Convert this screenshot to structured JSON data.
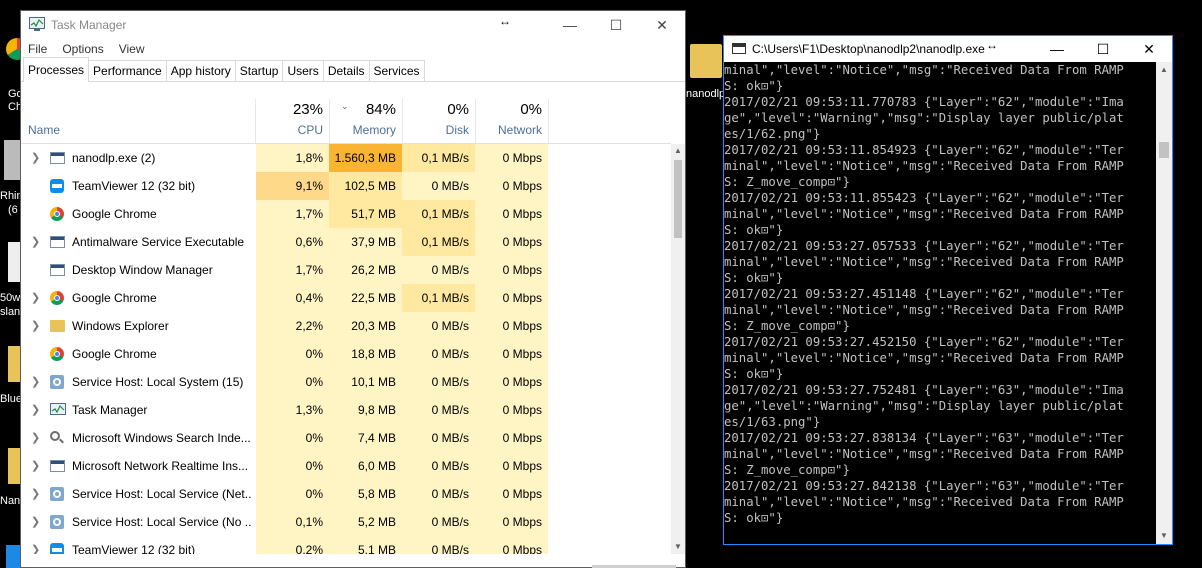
{
  "desktop": {
    "left_labels": [
      "Go",
      "Ch",
      "Rhin",
      "(6",
      "50w",
      "slan",
      "Blue",
      "Nan"
    ],
    "folder_label": "nanodlp"
  },
  "task_manager": {
    "title": "Task Manager",
    "menu": [
      "File",
      "Options",
      "View"
    ],
    "tabs": [
      "Processes",
      "Performance",
      "App history",
      "Startup",
      "Users",
      "Details",
      "Services"
    ],
    "active_tab": "Processes",
    "columns": {
      "name": "Name",
      "cpu": {
        "label": "CPU",
        "pct": "23%"
      },
      "memory": {
        "label": "Memory",
        "pct": "84%"
      },
      "disk": {
        "label": "Disk",
        "pct": "0%"
      },
      "network": {
        "label": "Network",
        "pct": "0%"
      }
    },
    "processes": [
      {
        "expand": true,
        "icon": "app-window-icon",
        "name": "nanodlp.exe (2)",
        "cpu": "1,8%",
        "mem": "1.560,3 MB",
        "disk": "0,1 MB/s",
        "net": "0 Mbps"
      },
      {
        "expand": false,
        "icon": "teamviewer-icon",
        "name": "TeamViewer 12 (32 bit)",
        "cpu": "9,1%",
        "mem": "102,5 MB",
        "disk": "0 MB/s",
        "net": "0 Mbps"
      },
      {
        "expand": false,
        "icon": "chrome-icon",
        "name": "Google Chrome",
        "cpu": "1,7%",
        "mem": "51,7 MB",
        "disk": "0,1 MB/s",
        "net": "0 Mbps"
      },
      {
        "expand": true,
        "icon": "app-window-icon",
        "name": "Antimalware Service Executable",
        "cpu": "0,6%",
        "mem": "37,9 MB",
        "disk": "0,1 MB/s",
        "net": "0 Mbps"
      },
      {
        "expand": false,
        "icon": "app-window-icon",
        "name": "Desktop Window Manager",
        "cpu": "1,7%",
        "mem": "26,2 MB",
        "disk": "0 MB/s",
        "net": "0 Mbps"
      },
      {
        "expand": true,
        "icon": "chrome-icon",
        "name": "Google Chrome",
        "cpu": "0,4%",
        "mem": "22,5 MB",
        "disk": "0,1 MB/s",
        "net": "0 Mbps"
      },
      {
        "expand": true,
        "icon": "folder-icon",
        "name": "Windows Explorer",
        "cpu": "2,2%",
        "mem": "20,3 MB",
        "disk": "0 MB/s",
        "net": "0 Mbps"
      },
      {
        "expand": false,
        "icon": "chrome-icon",
        "name": "Google Chrome",
        "cpu": "0%",
        "mem": "18,8 MB",
        "disk": "0 MB/s",
        "net": "0 Mbps"
      },
      {
        "expand": true,
        "icon": "gear-icon",
        "name": "Service Host: Local System (15)",
        "cpu": "0%",
        "mem": "10,1 MB",
        "disk": "0 MB/s",
        "net": "0 Mbps"
      },
      {
        "expand": true,
        "icon": "task-manager-icon",
        "name": "Task Manager",
        "cpu": "1,3%",
        "mem": "9,8 MB",
        "disk": "0 MB/s",
        "net": "0 Mbps"
      },
      {
        "expand": true,
        "icon": "search-person-icon",
        "name": "Microsoft Windows Search Inde...",
        "cpu": "0%",
        "mem": "7,4 MB",
        "disk": "0 MB/s",
        "net": "0 Mbps"
      },
      {
        "expand": true,
        "icon": "app-window-icon",
        "name": "Microsoft Network Realtime Ins...",
        "cpu": "0%",
        "mem": "6,0 MB",
        "disk": "0 MB/s",
        "net": "0 Mbps"
      },
      {
        "expand": true,
        "icon": "gear-icon",
        "name": "Service Host: Local Service (Net...",
        "cpu": "0%",
        "mem": "5,8 MB",
        "disk": "0 MB/s",
        "net": "0 Mbps"
      },
      {
        "expand": true,
        "icon": "gear-icon",
        "name": "Service Host: Local Service (No ...",
        "cpu": "0,1%",
        "mem": "5,2 MB",
        "disk": "0 MB/s",
        "net": "0 Mbps"
      },
      {
        "expand": true,
        "icon": "teamviewer-icon",
        "name": "TeamViewer 12 (32 bit)",
        "cpu": "0,2%",
        "mem": "5,1 MB",
        "disk": "0 MB/s",
        "net": "0 Mbps"
      }
    ],
    "colors": {
      "cell_light": "#fff4c4",
      "cell_mid": "#ffe8a0",
      "cell_high": "#ffd27a",
      "mem_hot": "#f9b532",
      "cpu_warm": "#ffd98a"
    }
  },
  "console": {
    "title": "C:\\Users\\F1\\Desktop\\nanodlp2\\nanodlp.exe",
    "lines": [
      "minal\",\"level\":\"Notice\",\"msg\":\"Received Data From RAMP",
      "S: ok⊡\"}",
      "2017/02/21 09:53:11.770783 {\"Layer\":\"62\",\"module\":\"Ima",
      "ge\",\"level\":\"Warning\",\"msg\":\"Display layer public/plat",
      "es/1/62.png\"}",
      "2017/02/21 09:53:11.854923 {\"Layer\":\"62\",\"module\":\"Ter",
      "minal\",\"level\":\"Notice\",\"msg\":\"Received Data From RAMP",
      "S: Z_move_comp⊡\"}",
      "2017/02/21 09:53:11.855423 {\"Layer\":\"62\",\"module\":\"Ter",
      "minal\",\"level\":\"Notice\",\"msg\":\"Received Data From RAMP",
      "S: ok⊡\"}",
      "2017/02/21 09:53:27.057533 {\"Layer\":\"62\",\"module\":\"Ter",
      "minal\",\"level\":\"Notice\",\"msg\":\"Received Data From RAMP",
      "S: ok⊡\"}",
      "2017/02/21 09:53:27.451148 {\"Layer\":\"62\",\"module\":\"Ter",
      "minal\",\"level\":\"Notice\",\"msg\":\"Received Data From RAMP",
      "S: Z_move_comp⊡\"}",
      "2017/02/21 09:53:27.452150 {\"Layer\":\"62\",\"module\":\"Ter",
      "minal\",\"level\":\"Notice\",\"msg\":\"Received Data From RAMP",
      "S: ok⊡\"}",
      "2017/02/21 09:53:27.752481 {\"Layer\":\"63\",\"module\":\"Ima",
      "ge\",\"level\":\"Warning\",\"msg\":\"Display layer public/plat",
      "es/1/63.png\"}",
      "2017/02/21 09:53:27.838134 {\"Layer\":\"63\",\"module\":\"Ter",
      "minal\",\"level\":\"Notice\",\"msg\":\"Received Data From RAMP",
      "S: Z_move_comp⊡\"}",
      "2017/02/21 09:53:27.842138 {\"Layer\":\"63\",\"module\":\"Ter",
      "minal\",\"level\":\"Notice\",\"msg\":\"Received Data From RAMP",
      "S: ok⊡\"}"
    ]
  }
}
